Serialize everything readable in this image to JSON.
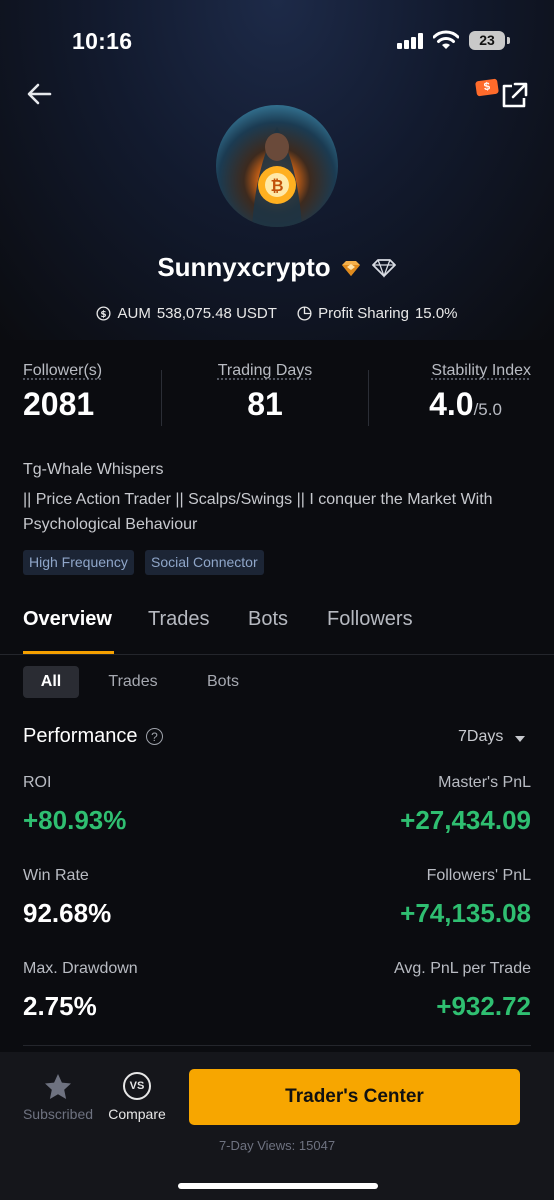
{
  "status_bar": {
    "time": "10:16",
    "battery": "23"
  },
  "profile": {
    "name": "Sunnyxcrypto",
    "aum_label": "AUM",
    "aum_value": "538,075.48 USDT",
    "profit_sharing_label": "Profit Sharing",
    "profit_sharing_value": "15.0%"
  },
  "share_badge": "$",
  "stats": [
    {
      "label": "Follower(s)",
      "value": "2081"
    },
    {
      "label": "Trading Days",
      "value": "81"
    },
    {
      "label": "Stability Index",
      "value": "4.0",
      "suffix": "/5.0"
    }
  ],
  "bio": {
    "title": "Tg-Whale Whispers",
    "text": "|| Price Action Trader || Scalps/Swings || I conquer the Market With Psychological Behaviour"
  },
  "tags": [
    "High Frequency",
    "Social Connector"
  ],
  "tabs": [
    "Overview",
    "Trades",
    "Bots",
    "Followers"
  ],
  "subtabs": [
    "All",
    "Trades",
    "Bots"
  ],
  "performance": {
    "title": "Performance",
    "help": "?",
    "period": "7Days",
    "metrics": [
      {
        "label": "ROI",
        "value": "+80.93%",
        "label_r": "Master's PnL",
        "value_r": "+27,434.09"
      },
      {
        "label": "Win Rate",
        "value": "92.68%",
        "label_r": "Followers' PnL",
        "value_r": "+74,135.08"
      },
      {
        "label": "Max. Drawdown",
        "value": "2.75%",
        "label_r": "Avg. PnL per Trade",
        "value_r": "+932.72"
      }
    ]
  },
  "bottom": {
    "subscribed": "Subscribed",
    "compare": "Compare",
    "compare_icon_text": "VS",
    "cta": "Trader's Center",
    "views": "7-Day Views: 15047"
  },
  "colors": {
    "accent": "#f7a600",
    "positive": "#2fbf71",
    "tag_text": "#8fa6c9"
  }
}
